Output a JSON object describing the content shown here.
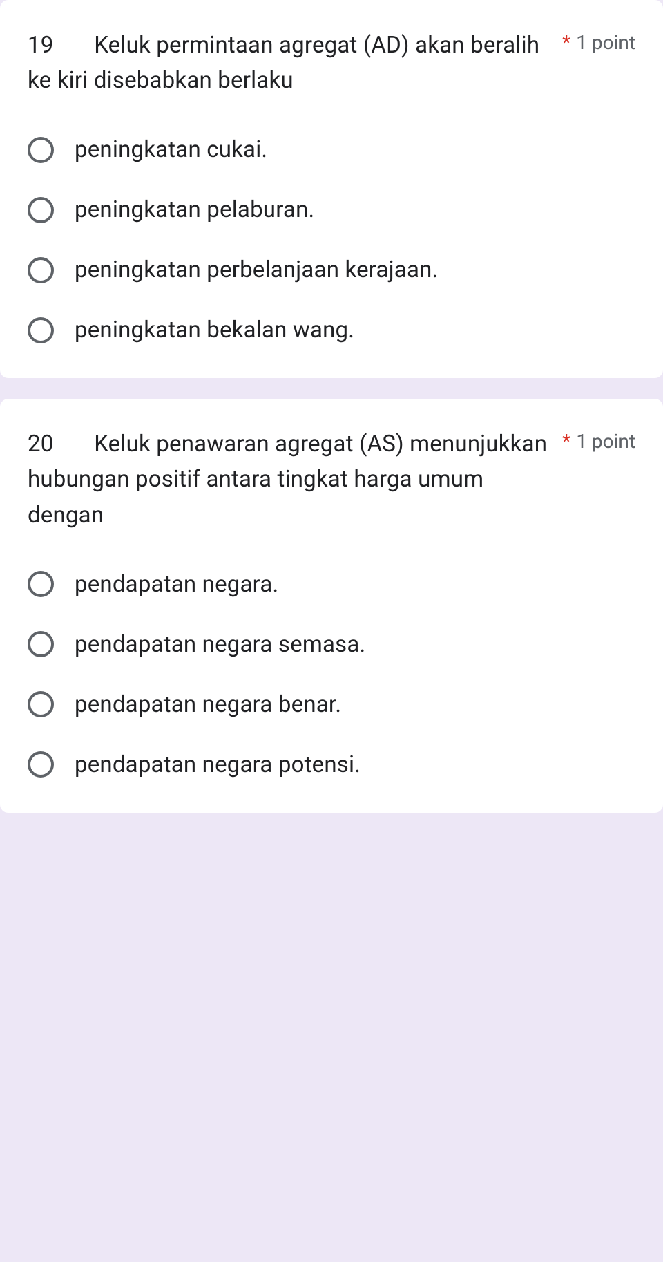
{
  "questions": [
    {
      "number": "19",
      "text": "19       Keluk permintaan agregat (AD) akan beralih ke kiri disebabkan berlaku",
      "required_mark": "*",
      "points": "1 point",
      "options": [
        "peningkatan cukai.",
        "peningkatan pelaburan.",
        "peningkatan perbelanjaan kerajaan.",
        "peningkatan bekalan wang."
      ]
    },
    {
      "number": "20",
      "text": "20       Keluk penawaran agregat (AS) menunjukkan hubungan positif antara tingkat harga umum dengan",
      "required_mark": "*",
      "points": "1 point",
      "options": [
        "pendapatan negara.",
        "pendapatan negara semasa.",
        "pendapatan negara benar.",
        "pendapatan negara potensi."
      ]
    }
  ]
}
